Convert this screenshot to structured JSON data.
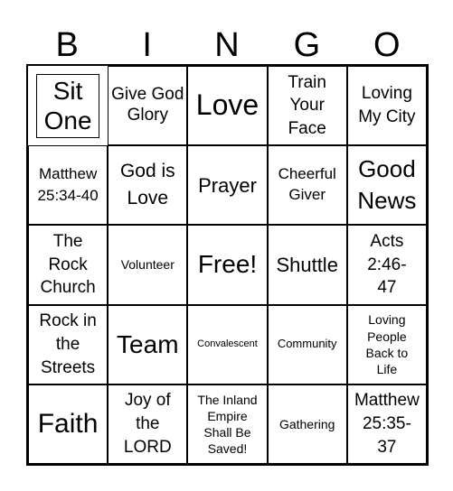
{
  "header": [
    "B",
    "I",
    "N",
    "G",
    "O"
  ],
  "rows": [
    [
      "Sit One",
      "Give God Glory",
      "Love",
      "Train Your Face",
      "Loving My City"
    ],
    [
      "Matthew 25:34-40",
      "God is Love",
      "Prayer",
      "Cheerful Giver",
      "Good News"
    ],
    [
      "The Rock Church",
      "Volunteer",
      "Free!",
      "Shuttle",
      "Acts 2:46-47"
    ],
    [
      "Rock in the Streets",
      "Team",
      "Convalescent",
      "Community",
      "Loving People Back to Life"
    ],
    [
      "Faith",
      "Joy of the LORD",
      "The Inland Empire Shall Be Saved!",
      "Gathering",
      "Matthew 25:35-37"
    ]
  ]
}
